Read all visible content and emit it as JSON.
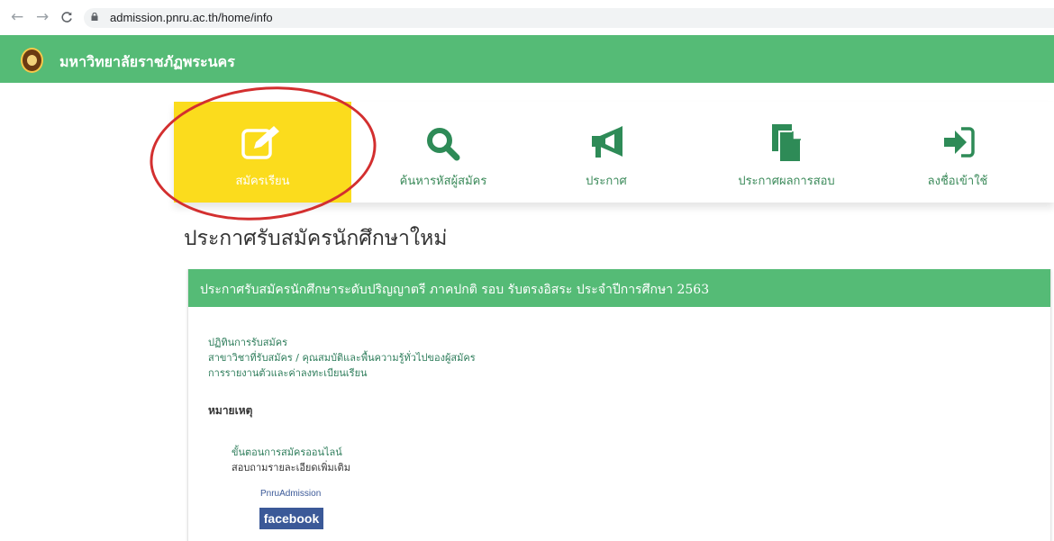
{
  "browser": {
    "back_icon": "arrow-left-icon",
    "forward_icon": "arrow-right-icon",
    "reload_icon": "reload-icon",
    "url": "admission.pnru.ac.th/home/info"
  },
  "header": {
    "site_title": "มหาวิทยาลัยราชภัฏพระนคร",
    "color": "#55bb76"
  },
  "menu": {
    "items": [
      {
        "label": "สมัครเรียน",
        "icon": "edit-icon",
        "active": true
      },
      {
        "label": "ค้นหารหัสผู้สมัคร",
        "icon": "search-icon"
      },
      {
        "label": "ประกาศ",
        "icon": "megaphone-icon"
      },
      {
        "label": "ประกาศผลการสอบ",
        "icon": "document-icon"
      },
      {
        "label": "ลงชื่อเข้าใช้",
        "icon": "sign-in-icon"
      }
    ],
    "active_color": "#fbdc1d"
  },
  "page": {
    "heading": "ประกาศรับสมัครนักศึกษาใหม่"
  },
  "card": {
    "title": "ประกาศรับสมัครนักศึกษาระดับปริญญาตรี ภาคปกติ รอบ รับตรงอิสระ ประจำปีการศึกษา 2563",
    "links": [
      "ปฏิทินการรับสมัคร",
      "สาขาวิชาที่รับสมัคร / คุณสมบัติและพื้นความรู้ทั่วไปของผู้สมัคร",
      "การรายงานตัวและค่าลงทะเบียนเรียน"
    ],
    "note_heading": "หมายเหตุ",
    "steps_link": "ขั้นตอนการสมัครออนไลน์",
    "inquiry_text": "สอบถามรายละเอียดเพิ่มเติม",
    "fb_page": "PnruAdmission",
    "fb_button": "facebook"
  }
}
